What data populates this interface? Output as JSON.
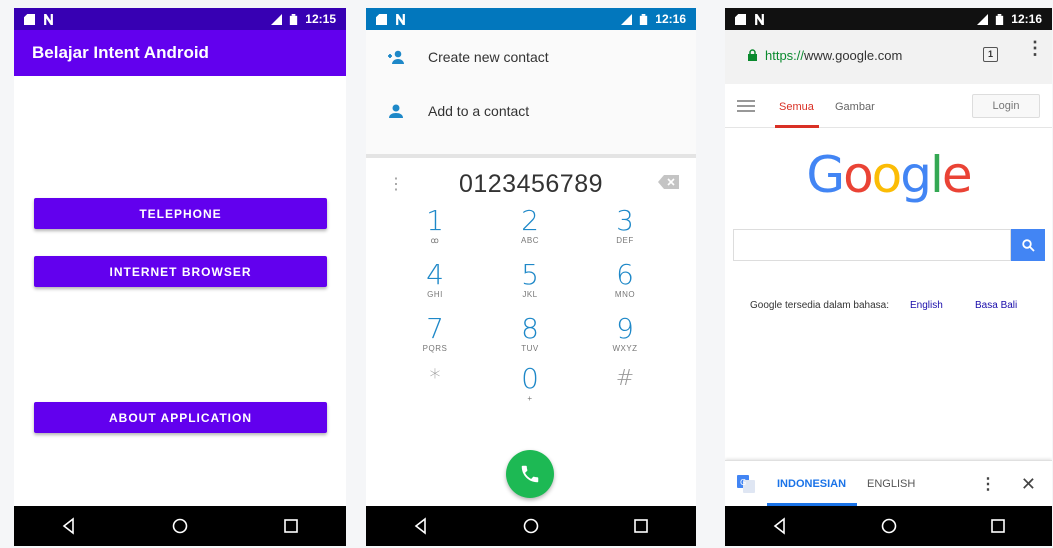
{
  "phone1": {
    "status": {
      "time": "12:15"
    },
    "app_title": "Belajar Intent Android",
    "buttons": {
      "telephone": "TELEPHONE",
      "browser": "INTERNET BROWSER",
      "about": "ABOUT APPLICATION"
    },
    "colors": {
      "primary": "#6200ee",
      "primary_dark": "#3700b3"
    }
  },
  "phone2": {
    "status": {
      "time": "12:16"
    },
    "suggestions": [
      "Create new contact",
      "Add to a contact"
    ],
    "number": "0123456789",
    "keys": [
      {
        "digit": "1",
        "letters": "ꝏ"
      },
      {
        "digit": "2",
        "letters": "ABC"
      },
      {
        "digit": "3",
        "letters": "DEF"
      },
      {
        "digit": "4",
        "letters": "GHI"
      },
      {
        "digit": "5",
        "letters": "JKL"
      },
      {
        "digit": "6",
        "letters": "MNO"
      },
      {
        "digit": "7",
        "letters": "PQRS"
      },
      {
        "digit": "8",
        "letters": "TUV"
      },
      {
        "digit": "9",
        "letters": "WXYZ"
      },
      {
        "digit": "*",
        "letters": ""
      },
      {
        "digit": "0",
        "letters": "+"
      },
      {
        "digit": "#",
        "letters": ""
      }
    ],
    "colors": {
      "accent": "#1e88c8",
      "call": "#1db954"
    }
  },
  "phone3": {
    "status": {
      "time": "12:16"
    },
    "url_scheme": "https://",
    "url_host": "www.google.com",
    "tab_count": "1",
    "tabs": {
      "all": "Semua",
      "images": "Gambar"
    },
    "login": "Login",
    "logo": {
      "G": "G",
      "o1": "o",
      "o2": "o",
      "g": "g",
      "l": "l",
      "e": "e"
    },
    "lang_prefix": "Google tersedia dalam bahasa:",
    "lang_links": [
      "English",
      "Basa Bali"
    ],
    "translate": {
      "from": "INDONESIAN",
      "to": "ENGLISH"
    }
  }
}
